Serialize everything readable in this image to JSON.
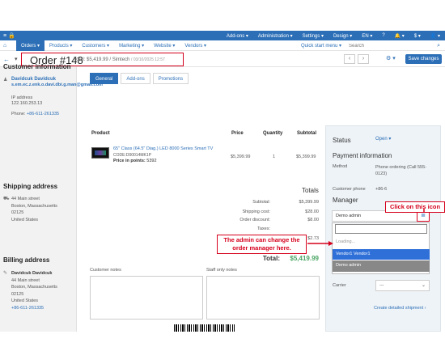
{
  "topbar": {
    "left_icons": "≡ 🔒",
    "items": [
      "Add-ons ▾",
      "Administration ▾",
      "Settings ▾",
      "Design ▾",
      "EN ▾",
      "?",
      "🔔 ▾",
      "$ ▾",
      "👤 ▾"
    ]
  },
  "navbar": {
    "home_icon": "home-icon",
    "tabs": [
      "Orders ▾",
      "Products ▾",
      "Customers ▾",
      "Marketing ▾",
      "Website ▾",
      "Vendors ▾"
    ],
    "quick_start": "Quick start menu ▾",
    "search_placeholder": "Search"
  },
  "order": {
    "title": "Order #148",
    "summary": "Total: $5,419.99 / Simtech",
    "date": "/ 03/10/2025 12:57",
    "save_label": "Save changes"
  },
  "customer": {
    "heading": "Customer information",
    "name": "Davidcuk Davidcuk",
    "email": "s.em.ec.z.enk.o.davi.dbi.g.man@gmail.com",
    "ip_label": "IP address",
    "ip": "122.160.253.13",
    "phone_label": "Phone:",
    "phone": "+86-611-261335"
  },
  "shipping": {
    "heading": "Shipping address",
    "lines": [
      "44 Main street",
      "Boston, Massachusetts",
      "02125",
      "United States"
    ]
  },
  "billing": {
    "heading": "Billing address",
    "name": "Davidcuk Davidcuk",
    "lines": [
      "44 Main street",
      "Boston, Massachusetts",
      "02125",
      "United States"
    ],
    "phone": "+86-611-261335"
  },
  "tabs": [
    "General",
    "Add-ons",
    "Promotions"
  ],
  "products": {
    "headers": [
      "Product",
      "Price",
      "Quantity",
      "Subtotal"
    ],
    "rows": [
      {
        "name": "65\" Class (64.5\" Diag.) LED 8000 Series Smart TV",
        "code": "CODE:D00014MK1P",
        "points_label": "Price in points:",
        "points": "5392",
        "price": "$5,399.99",
        "qty": "1",
        "subtotal": "$5,399.99"
      }
    ]
  },
  "totals": {
    "heading": "Totals",
    "rows": [
      {
        "label": "Subtotal:",
        "value": "$5,399.99"
      },
      {
        "label": "Shipping cost:",
        "value": "$28.00"
      },
      {
        "label": "Order discount:",
        "value": "$8.00"
      },
      {
        "label": "Taxes:",
        "value": ""
      },
      {
        "label": "",
        "value": "$2.73"
      }
    ],
    "total_label": "Total:",
    "total_value": "$5,419.99"
  },
  "notes": {
    "customer": "Customer notes",
    "staff": "Staff only notes"
  },
  "right": {
    "status_label": "Status",
    "status_value": "Open ▾",
    "payment_heading": "Payment information",
    "method_label": "Method",
    "method_value": "Phone ordering (Call 555-0123)",
    "phone_label": "Customer phone",
    "phone_value": "+86-6",
    "manager_heading": "Manager",
    "manager_value": "Demo admin",
    "list_icon": "list-icon",
    "dropdown": {
      "loading": "Loading...",
      "options": [
        "Vendor1 Vendor1",
        "Demo admin"
      ]
    },
    "carrier_label": "Carrier",
    "carrier_value": "---",
    "create_shipment": "Create detailed shipment ›"
  },
  "annotations": {
    "click_icon": "Click on this icon",
    "change_manager": "The admin can change the order manager here."
  },
  "colors": {
    "accent": "#2c6fb7",
    "annotation": "#d6001c",
    "total_green": "#4aa564",
    "selected": "#2e6fd8"
  }
}
